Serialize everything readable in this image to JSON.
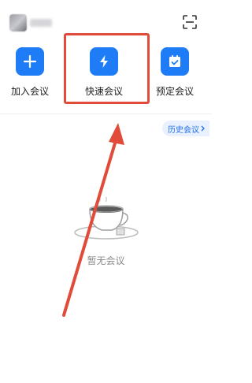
{
  "header": {
    "user_avatar": "blurred-avatar",
    "scan_icon": "scan-icon"
  },
  "actions": [
    {
      "label": "加入会议",
      "icon": "plus-icon"
    },
    {
      "label": "快速会议",
      "icon": "lightning-icon"
    },
    {
      "label": "预定会议",
      "icon": "calendar-check-icon"
    }
  ],
  "history": {
    "label": "历史会议"
  },
  "empty_state": {
    "message": "暂无会议",
    "icon": "coffee-cup-icon"
  },
  "colors": {
    "accent": "#1f7cf7",
    "annotation": "#e04b3a"
  }
}
